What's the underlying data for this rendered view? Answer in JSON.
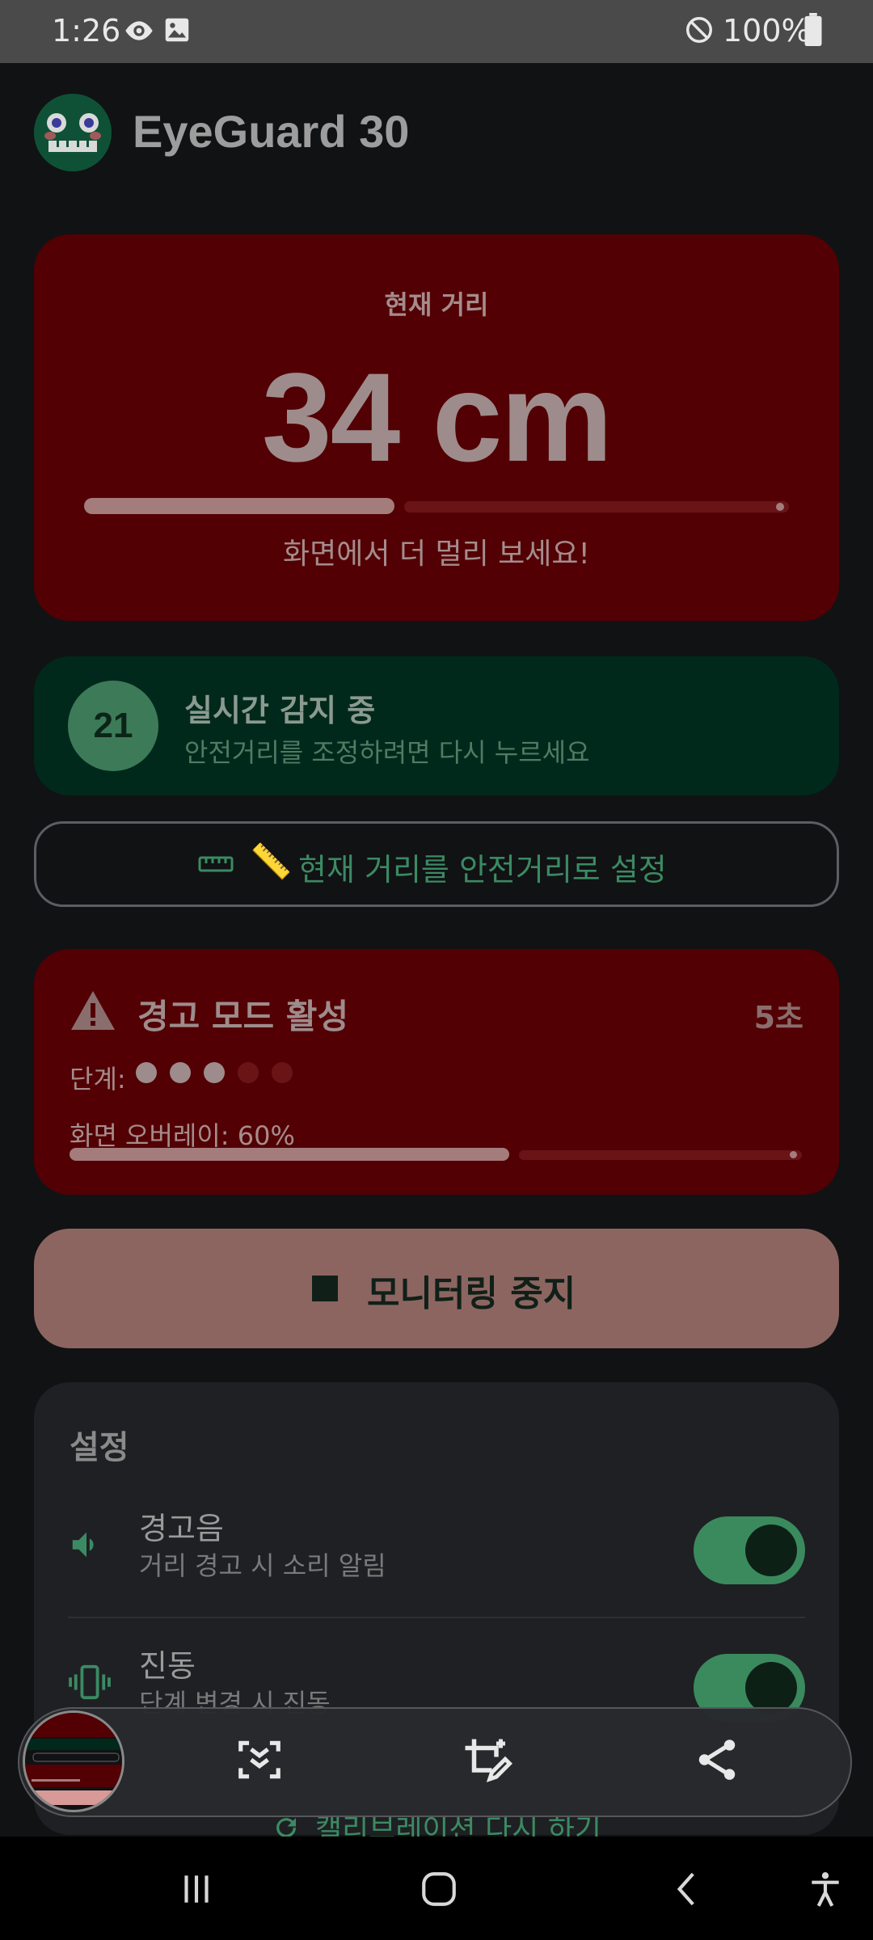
{
  "status_bar": {
    "time": "1:26",
    "battery": "100%",
    "icons": [
      "eye-icon",
      "image-icon",
      "do-not-disturb-icon",
      "battery-full-icon"
    ]
  },
  "app": {
    "title": "EyeGuard 30",
    "logo_icon": "eyeguard-logo-icon"
  },
  "distance_card": {
    "label": "현재 거리",
    "value": "34 cm",
    "progress": 0.44,
    "message": "화면에서 더 멀리 보세요!",
    "bg_color": "#520004"
  },
  "detection_card": {
    "number": "21",
    "title": "실시간 감지 중",
    "subtitle": "안전거리를 조정하려면 다시 누르세요",
    "bg_color": "#00291C"
  },
  "set_distance_button": {
    "icons": [
      "ruler-icon",
      "pencil-icon"
    ],
    "emoji": "📏",
    "label": "현재 거리를 안전거리로 설정"
  },
  "warning_card": {
    "icon": "warning-icon",
    "title": "경고 모드 활성",
    "seconds": "5초",
    "level_label": "단계:",
    "level_active": 3,
    "level_total": 5,
    "overlay_label": "화면 오버레이: 60%",
    "overlay_progress": 0.6
  },
  "stop_button": {
    "icon": "stop-icon",
    "label": "모니터링 중지",
    "bg_color": "#8C6561"
  },
  "settings": {
    "title": "설정",
    "items": [
      {
        "icon": "speaker-icon",
        "title": "경고음",
        "subtitle": "거리 경고 시 소리 알림",
        "enabled": true
      },
      {
        "icon": "vibration-icon",
        "title": "진동",
        "subtitle": "단계 변경 시 진동",
        "enabled": true
      }
    ],
    "recalibrate_label": "캘리브레이션 다시 하기",
    "recalibrate_icon": "refresh-icon"
  },
  "screenshot_toolbar": {
    "icons": [
      "screenshot-thumbnail",
      "scroll-capture-icon",
      "crop-edit-icon",
      "share-icon"
    ]
  },
  "nav_bar": {
    "icons": [
      "recents-icon",
      "home-icon",
      "back-icon",
      "accessibility-icon"
    ]
  },
  "colors": {
    "accent_green": "#3B8A63",
    "warning_red": "#520004",
    "background": "#111214"
  }
}
